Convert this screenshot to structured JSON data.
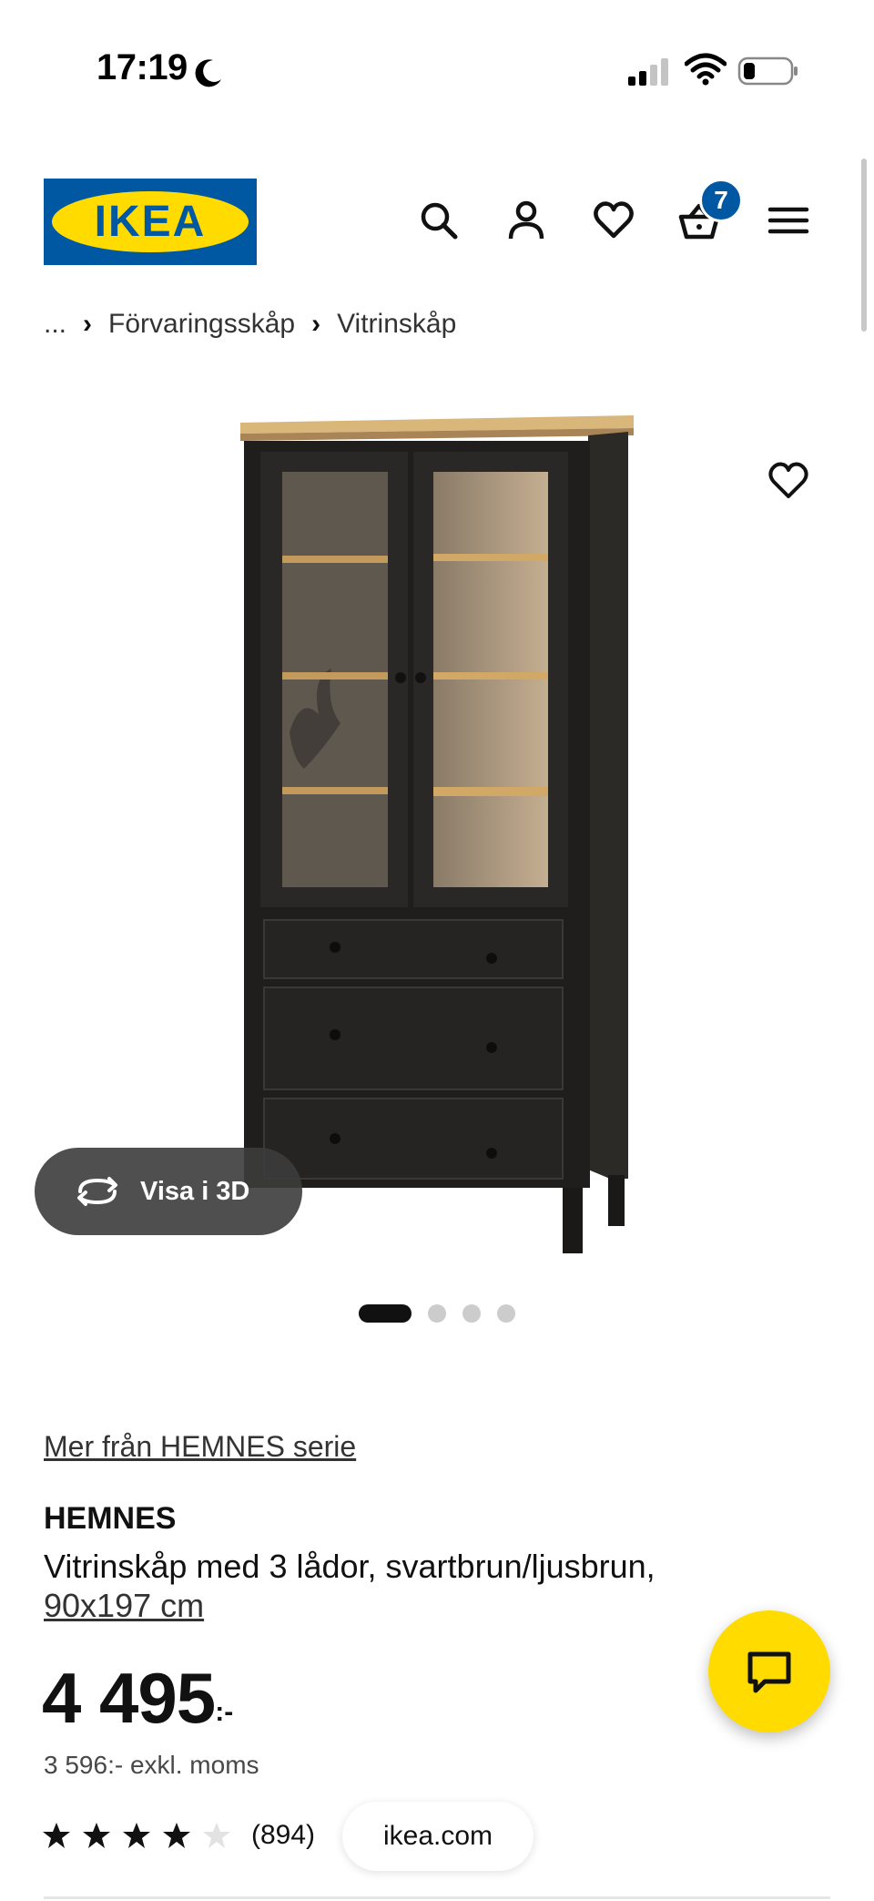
{
  "status_bar": {
    "time": "17:19",
    "icons": [
      "moon-icon",
      "cellular-signal-icon",
      "wifi-icon",
      "battery-icon"
    ]
  },
  "header": {
    "logo_text": "IKEA",
    "icons": [
      "search-icon",
      "account-icon",
      "heart-icon",
      "cart-icon",
      "menu-icon"
    ],
    "cart_count": "7",
    "colors": {
      "brand_blue": "#0058a3",
      "brand_yellow": "#ffdb00"
    }
  },
  "breadcrumb": {
    "ellipsis": "...",
    "items": [
      "Förvaringsskåp",
      "Vitrinskåp"
    ]
  },
  "gallery": {
    "view_3d_label": "Visa i 3D",
    "dots_total": 4,
    "active_dot": 1
  },
  "product": {
    "series_link": "Mer från HEMNES serie",
    "name": "HEMNES",
    "description": "Vitrinskåp med 3 lådor, svartbrun/ljusbrun,",
    "size": "90x197 cm",
    "price": "4 495",
    "price_suffix": ":-",
    "price_excl_vat": "3 596:- exkl. moms",
    "rating_stars": 4,
    "rating_max": 5,
    "review_count": "(894)"
  },
  "browser": {
    "url": "ikea.com"
  },
  "chat": {
    "icon": "chat-icon"
  }
}
